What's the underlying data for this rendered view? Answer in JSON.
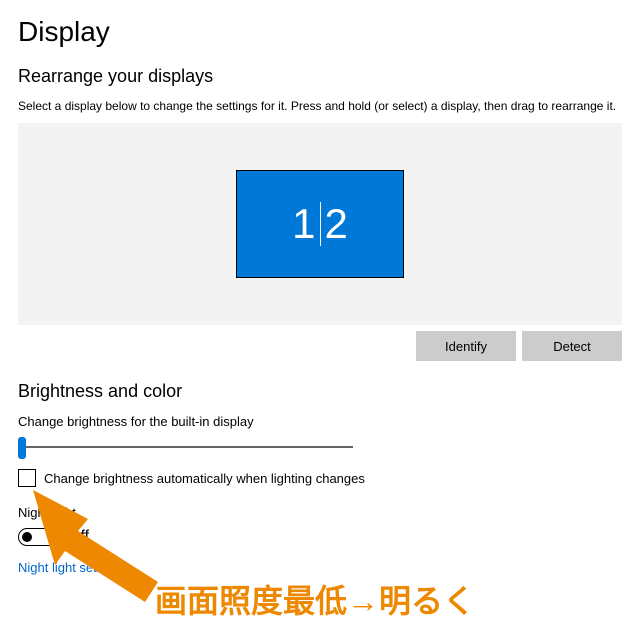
{
  "page_title": "Display",
  "rearrange": {
    "title": "Rearrange your displays",
    "hint": "Select a display below to change the settings for it. Press and hold (or select) a display, then drag to rearrange it.",
    "tile_left_label": "1",
    "tile_right_label": "2",
    "identify_label": "Identify",
    "detect_label": "Detect"
  },
  "brightness": {
    "section_title": "Brightness and color",
    "slider_label": "Change brightness for the built-in display",
    "slider_value": 0,
    "auto_checkbox_label": "Change brightness automatically when lighting changes",
    "auto_checked": false,
    "night_light_label": "Night light",
    "night_light_state": "Off",
    "night_light_on": false,
    "night_light_settings_link": "Night light settings"
  },
  "annotation": {
    "text": "画面照度最低→明るく",
    "color": "#ee8800"
  }
}
